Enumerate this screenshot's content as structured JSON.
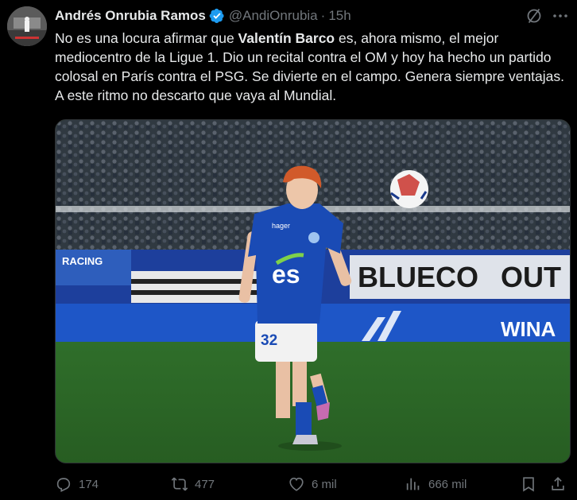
{
  "tweet": {
    "author_name": "Andrés Onrubia Ramos",
    "handle": "@AndiOnrubia",
    "separator": "·",
    "time": "15h",
    "text_parts": {
      "p1": "No es una locura afirmar que ",
      "bold1": "Valentín Barco",
      "p2": " es, ahora mismo, el mejor mediocentro de la Ligue 1. Dio un recital contra el OM y hoy ha hecho un partido colosal en París contra el PSG. Se divierte en el campo. Genera siempre ventajas. A este ritmo no descarto que vaya al Mundial."
    },
    "media": {
      "jersey_number": "32",
      "sponsor": "es",
      "board_text_1": "BLUECO",
      "board_text_2": "OUT",
      "board_text_3": "WINA",
      "board_text_4": "RACING",
      "shirt_brand": "hager"
    },
    "stats": {
      "replies": "174",
      "reposts": "477",
      "likes": "6 mil",
      "views": "666 mil"
    }
  },
  "colors": {
    "background": "#000000",
    "text": "#e7e9ea",
    "muted": "#71767b",
    "verified": "#1d9bf0",
    "jersey_blue": "#1a4bb5"
  },
  "icons": [
    "verified-badge-icon",
    "grok-icon",
    "more-icon",
    "reply-icon",
    "repost-icon",
    "like-icon",
    "views-icon",
    "bookmark-icon",
    "share-icon"
  ]
}
